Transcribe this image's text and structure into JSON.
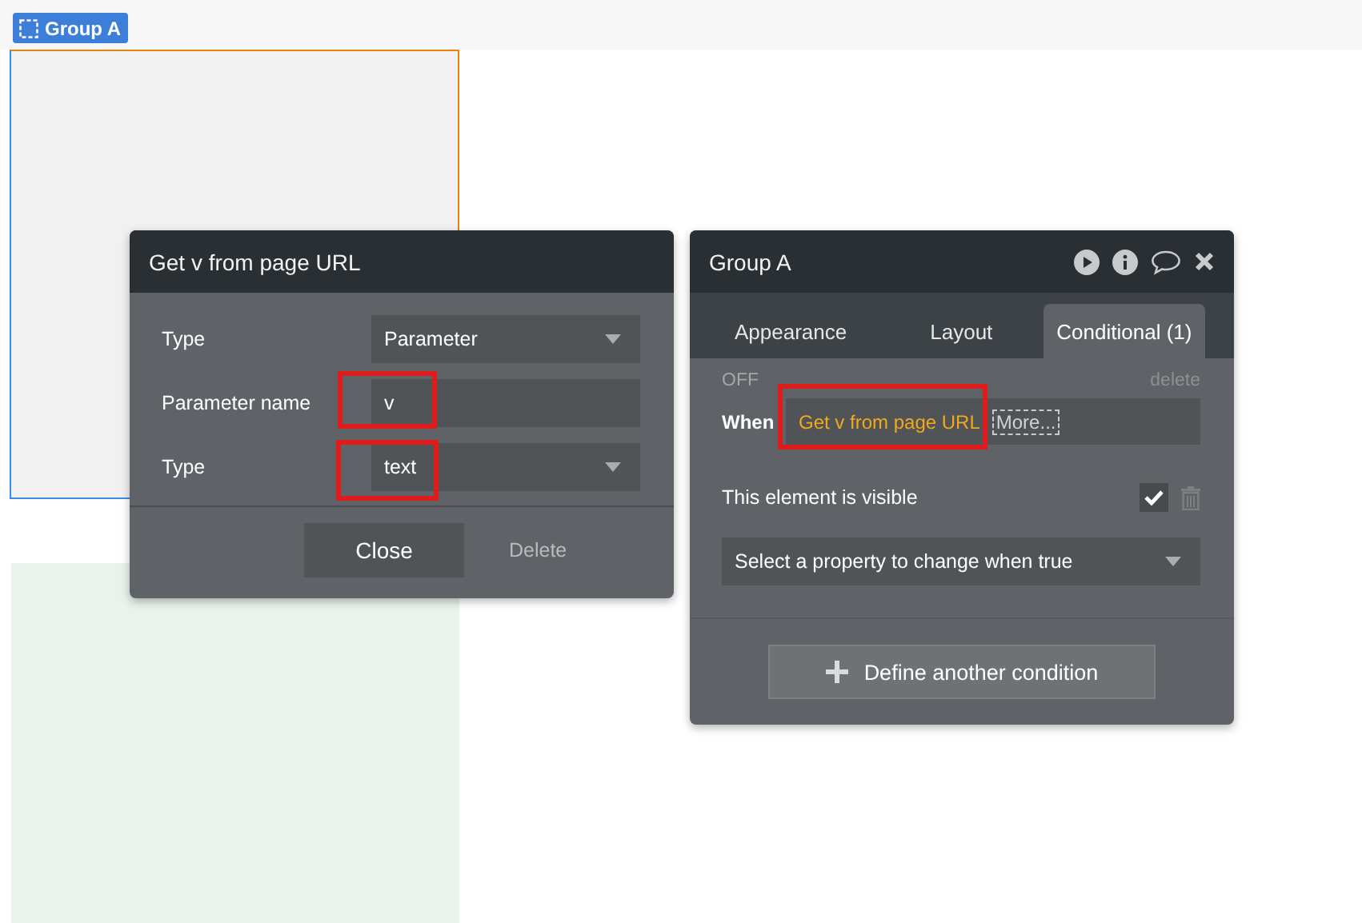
{
  "canvas_tag": {
    "label": "Group A"
  },
  "param_dialog": {
    "title": "Get v from page URL",
    "fields": [
      {
        "label": "Type",
        "kind": "dropdown",
        "value": "Parameter"
      },
      {
        "label": "Parameter name",
        "kind": "input",
        "value": "v"
      },
      {
        "label": "Type",
        "kind": "dropdown",
        "value": "text"
      }
    ],
    "buttons": [
      {
        "label": "Close",
        "kind": "primary"
      },
      {
        "label": "Delete",
        "kind": "link"
      }
    ]
  },
  "property_editor": {
    "title": "Group A",
    "tabs": [
      {
        "label": "Appearance",
        "selected": false
      },
      {
        "label": "Layout",
        "selected": false
      },
      {
        "label": "Conditional (1)",
        "selected": true
      }
    ],
    "condition": {
      "status": "OFF",
      "delete": "delete",
      "when_label": "When",
      "expression": "Get v from page URL",
      "more": "More...",
      "property": "This element is visible",
      "checked": true,
      "property_select": "Select a property to change when true"
    },
    "add_button": "Define another condition"
  }
}
